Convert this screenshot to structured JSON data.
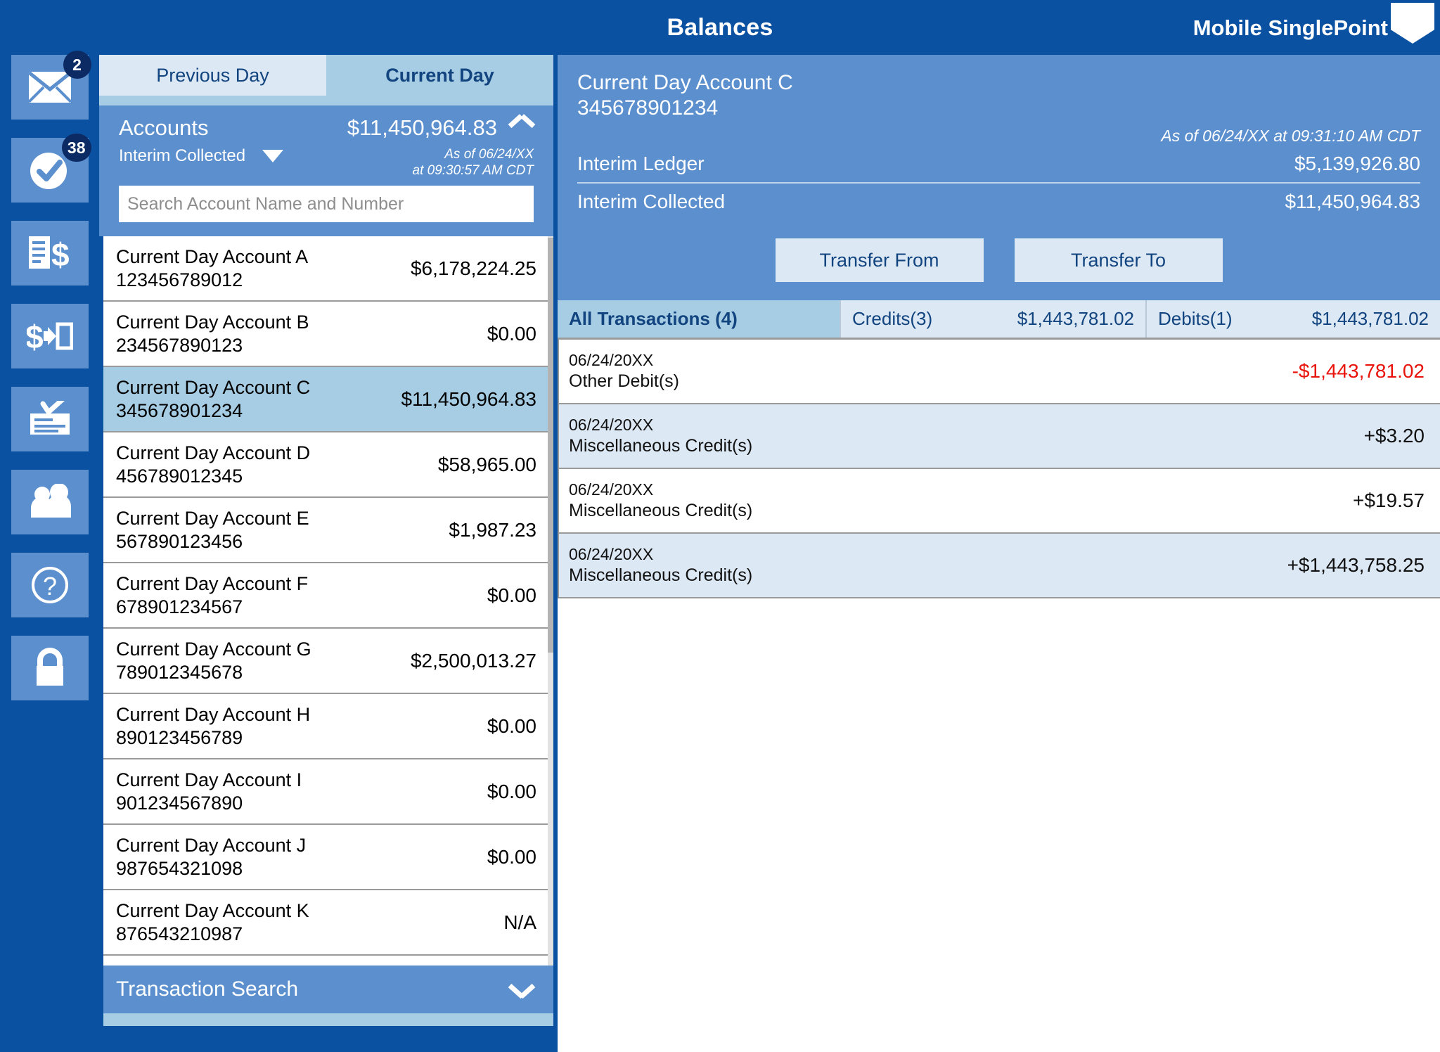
{
  "header": {
    "title": "Balances",
    "brand": "Mobile SinglePoint",
    "logo_icon": "shield-logo-icon"
  },
  "rail": {
    "items": [
      {
        "icon": "envelope-icon",
        "badge": "2",
        "name": "messages"
      },
      {
        "icon": "check-circle-icon",
        "badge": "38",
        "name": "approvals"
      },
      {
        "icon": "document-dollar-icon",
        "badge": "",
        "name": "reports"
      },
      {
        "icon": "dollar-transfer-icon",
        "badge": "",
        "name": "transfers"
      },
      {
        "icon": "check-deposit-icon",
        "badge": "",
        "name": "deposits"
      },
      {
        "icon": "users-icon",
        "badge": "",
        "name": "users"
      },
      {
        "icon": "question-circle-icon",
        "badge": "",
        "name": "help"
      },
      {
        "icon": "lock-icon",
        "badge": "",
        "name": "security"
      }
    ]
  },
  "tabs": {
    "previous_day": "Previous Day",
    "current_day": "Current Day"
  },
  "accounts_panel": {
    "title": "Accounts",
    "total": "$11,450,964.83",
    "filter_label": "Interim Collected",
    "as_of_line1": "As of 06/24/XX",
    "as_of_line2": "at 09:30:57 AM CDT",
    "search_placeholder": "Search Account Name and Number",
    "search_value": "",
    "collapse_icon": "chevron-up-icon",
    "filter_icon": "caret-down-icon",
    "items": [
      {
        "name": "Current Day Account A",
        "number": "123456789012",
        "balance": "$6,178,224.25",
        "selected": false
      },
      {
        "name": "Current Day Account B",
        "number": "234567890123",
        "balance": "$0.00",
        "selected": false
      },
      {
        "name": "Current Day Account C",
        "number": "345678901234",
        "balance": "$11,450,964.83",
        "selected": true
      },
      {
        "name": "Current Day Account D",
        "number": "456789012345",
        "balance": "$58,965.00",
        "selected": false
      },
      {
        "name": "Current Day Account E",
        "number": "567890123456",
        "balance": "$1,987.23",
        "selected": false
      },
      {
        "name": "Current Day Account F",
        "number": "678901234567",
        "balance": "$0.00",
        "selected": false
      },
      {
        "name": "Current Day Account G",
        "number": "789012345678",
        "balance": "$2,500,013.27",
        "selected": false
      },
      {
        "name": "Current Day Account H",
        "number": "890123456789",
        "balance": "$0.00",
        "selected": false
      },
      {
        "name": "Current Day Account I",
        "number": "901234567890",
        "balance": "$0.00",
        "selected": false
      },
      {
        "name": "Current Day Account J",
        "number": "987654321098",
        "balance": "$0.00",
        "selected": false
      },
      {
        "name": "Current Day Account K",
        "number": "876543210987",
        "balance": "N/A",
        "selected": false
      }
    ]
  },
  "transaction_search": {
    "label": "Transaction Search",
    "expand_icon": "chevron-down-icon"
  },
  "detail": {
    "account_name": "Current Day Account C",
    "account_number": "345678901234",
    "as_of": "As of 06/24/XX at 09:31:10 AM CDT",
    "interim_ledger_label": "Interim Ledger",
    "interim_ledger_value": "$5,139,926.80",
    "interim_collected_label": "Interim Collected",
    "interim_collected_value": "$11,450,964.83",
    "transfer_from": "Transfer From",
    "transfer_to": "Transfer To"
  },
  "transaction_tabs": [
    {
      "label": "All Transactions (4)",
      "amount": "",
      "active": true
    },
    {
      "label": "Credits(3)",
      "amount": "$1,443,781.02",
      "active": false
    },
    {
      "label": "Debits(1)",
      "amount": "$1,443,781.02",
      "active": false
    }
  ],
  "transactions": [
    {
      "date": "06/24/20XX",
      "description": "Other Debit(s)",
      "amount": "-$1,443,781.02",
      "negative": true
    },
    {
      "date": "06/24/20XX",
      "description": "Miscellaneous Credit(s)",
      "amount": "+$3.20",
      "negative": false
    },
    {
      "date": "06/24/20XX",
      "description": "Miscellaneous Credit(s)",
      "amount": "+$19.57",
      "negative": false
    },
    {
      "date": "06/24/20XX",
      "description": "Miscellaneous Credit(s)",
      "amount": "+$1,443,758.25",
      "negative": false
    }
  ],
  "colors": {
    "brand_blue": "#0a51a1",
    "panel_blue": "#5b8fcd",
    "tab_active": "#a7cde4",
    "tab_inactive": "#dce8f4",
    "text_blue": "#12447f",
    "negative_red": "#e8140b",
    "badge_navy": "#0c2a63"
  }
}
